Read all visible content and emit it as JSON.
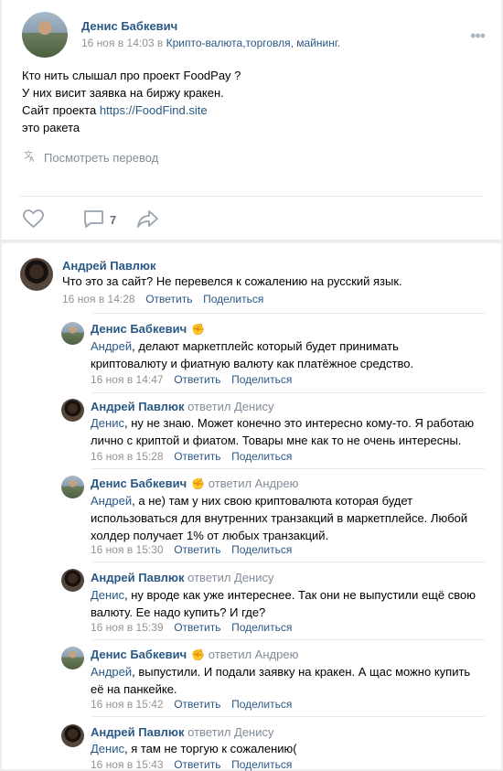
{
  "post": {
    "author": "Денис Бабкевич",
    "time": "16 ноя в 14:03 в",
    "place": "Крипто-валюта,торговля, майнинг.",
    "lines": [
      "Кто нить слышал про проект FoodPay ?",
      "У них висит заявка на биржу кракен.",
      "Сайт проекта ",
      "это ракета"
    ],
    "link": "https://FoodFind.site",
    "translate": "Посмотреть перевод",
    "comment_count": "7",
    "menu": "•••"
  },
  "comments": [
    {
      "name": "Андрей Павлюк",
      "reply_to": "",
      "mention": "",
      "text": "Что это за сайт? Не перевелся к сожалению на русский язык.",
      "date": "16 ноя в 14:28",
      "reply": "Ответить",
      "share": "Поделиться"
    },
    {
      "name": "Денис Бабкевич",
      "reply_to": "",
      "mention": "Андрей",
      "text_lines": [
        ", делают маркетплейс который будет принимать",
        "криптовалюту и фиатную валюту как платёжное средство."
      ],
      "date": "16 ноя в 14:47",
      "reply": "Ответить",
      "share": "Поделиться"
    },
    {
      "name": "Андрей Павлюк",
      "reply_to": "ответил Денису",
      "mention": "Денис",
      "text_lines": [
        ", ну не знаю. Может конечно это интересно кому-то. Я работаю",
        "лично с криптой и фиатом. Товары мне как то не очень интересны."
      ],
      "date": "16 ноя в 15:28",
      "reply": "Ответить",
      "share": "Поделиться"
    },
    {
      "name": "Денис Бабкевич",
      "reply_to": "ответил Андрею",
      "mention": "Андрей",
      "text_lines": [
        ", а не) там у них свою криптовалюта которая будет",
        "использоваться для внутренних транзакций в маркетплейсе. Любой",
        "холдер получает 1% от любых транзакций."
      ],
      "date": "16 ноя в 15:30",
      "reply": "Ответить",
      "share": "Поделиться"
    },
    {
      "name": "Андрей Павлюк",
      "reply_to": "ответил Денису",
      "mention": "Денис",
      "text_lines": [
        ", ну вроде как уже интереснее. Так они не выпустили ещё свою",
        "валюту. Ее надо купить? И где?"
      ],
      "date": "16 ноя в 15:39",
      "reply": "Ответить",
      "share": "Поделиться"
    },
    {
      "name": "Денис Бабкевич",
      "reply_to": "ответил Андрею",
      "mention": "Андрей",
      "text_lines": [
        ", выпустили. И подали заявку на кракен. А щас можно купить",
        "её на панкейке."
      ],
      "date": "16 ноя в 15:42",
      "reply": "Ответить",
      "share": "Поделиться"
    },
    {
      "name": "Андрей Павлюк",
      "reply_to": "ответил Денису",
      "mention": "Денис",
      "text_lines": [
        ", я там не торгую к сожалению("
      ],
      "date": "16 ноя в 15:43",
      "reply": "Ответить",
      "share": "Поделиться"
    }
  ],
  "icons": {
    "fist": "✊",
    "translate": "translate-icon",
    "like": "heart-icon",
    "comment": "comment-icon",
    "share": "share-arrow-icon"
  },
  "colors": {
    "link": "#2a5885",
    "muted": "#939393",
    "action": "#818c99",
    "background": "#edeef0"
  }
}
